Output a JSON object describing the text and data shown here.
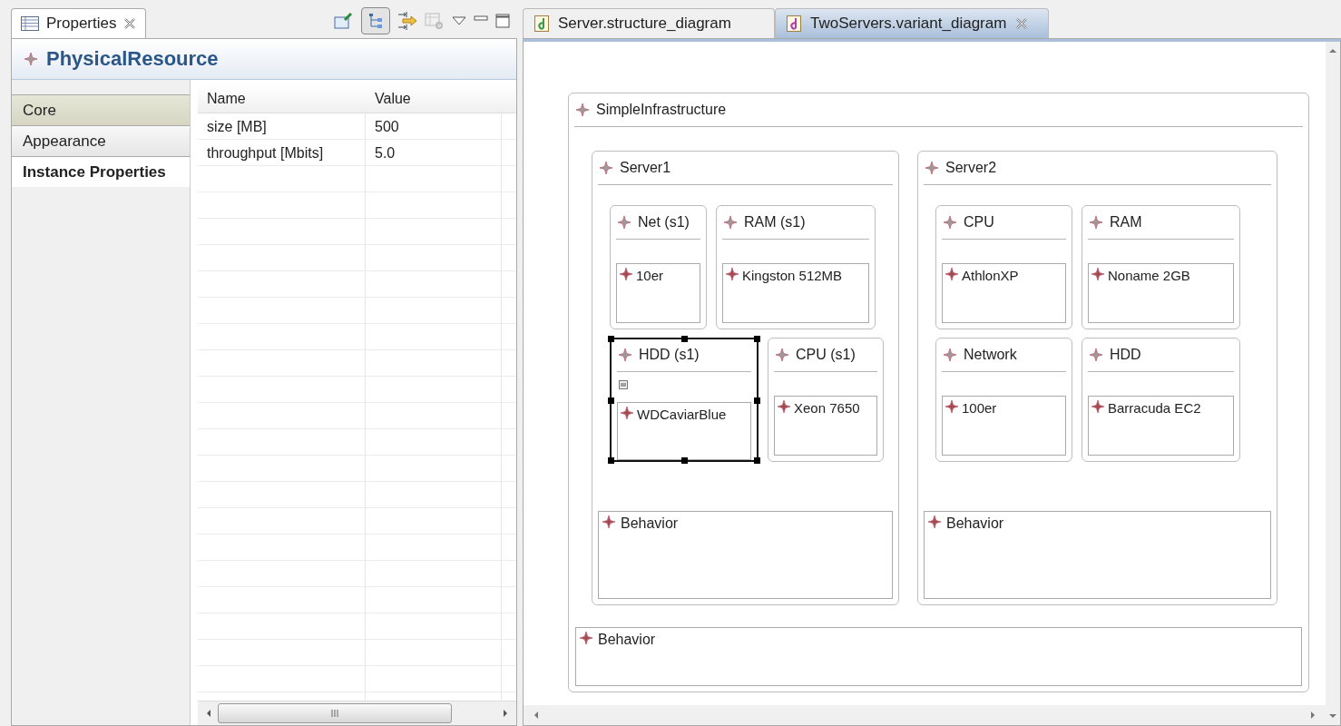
{
  "properties_view": {
    "tab": {
      "title": "Properties"
    },
    "header": "PhysicalResource",
    "sections": [
      {
        "label": "Core",
        "selected": false
      },
      {
        "label": "Appearance",
        "selected": false
      },
      {
        "label": "Instance Properties",
        "selected": true
      }
    ],
    "table": {
      "columns": [
        "Name",
        "Value"
      ],
      "rows": [
        [
          "size [MB]",
          "500"
        ],
        [
          "throughput [Mbits]",
          "5.0"
        ]
      ]
    }
  },
  "editor_tabs": [
    {
      "title": "Server.structure_diagram",
      "selected": false
    },
    {
      "title": "TwoServers.variant_diagram",
      "selected": true
    }
  ],
  "diagram": {
    "name": "SimpleInfrastructure",
    "behavior": "Behavior",
    "servers": [
      {
        "name": "Server1",
        "behavior": "Behavior",
        "components": [
          {
            "name": "Net (s1)",
            "instance": "10er",
            "selected": false
          },
          {
            "name": "RAM (s1)",
            "instance": "Kingston 512MB",
            "selected": false
          },
          {
            "name": "HDD (s1)",
            "instance": "WDCaviarBlue",
            "selected": true
          },
          {
            "name": "CPU (s1)",
            "instance": "Xeon 7650",
            "selected": false
          }
        ]
      },
      {
        "name": "Server2",
        "behavior": "Behavior",
        "components": [
          {
            "name": "CPU",
            "instance": "AthlonXP",
            "selected": false
          },
          {
            "name": "RAM",
            "instance": "Noname 2GB",
            "selected": false
          },
          {
            "name": "Network",
            "instance": "100er",
            "selected": false
          },
          {
            "name": "HDD",
            "instance": "Barracuda EC2",
            "selected": false
          }
        ]
      }
    ]
  }
}
